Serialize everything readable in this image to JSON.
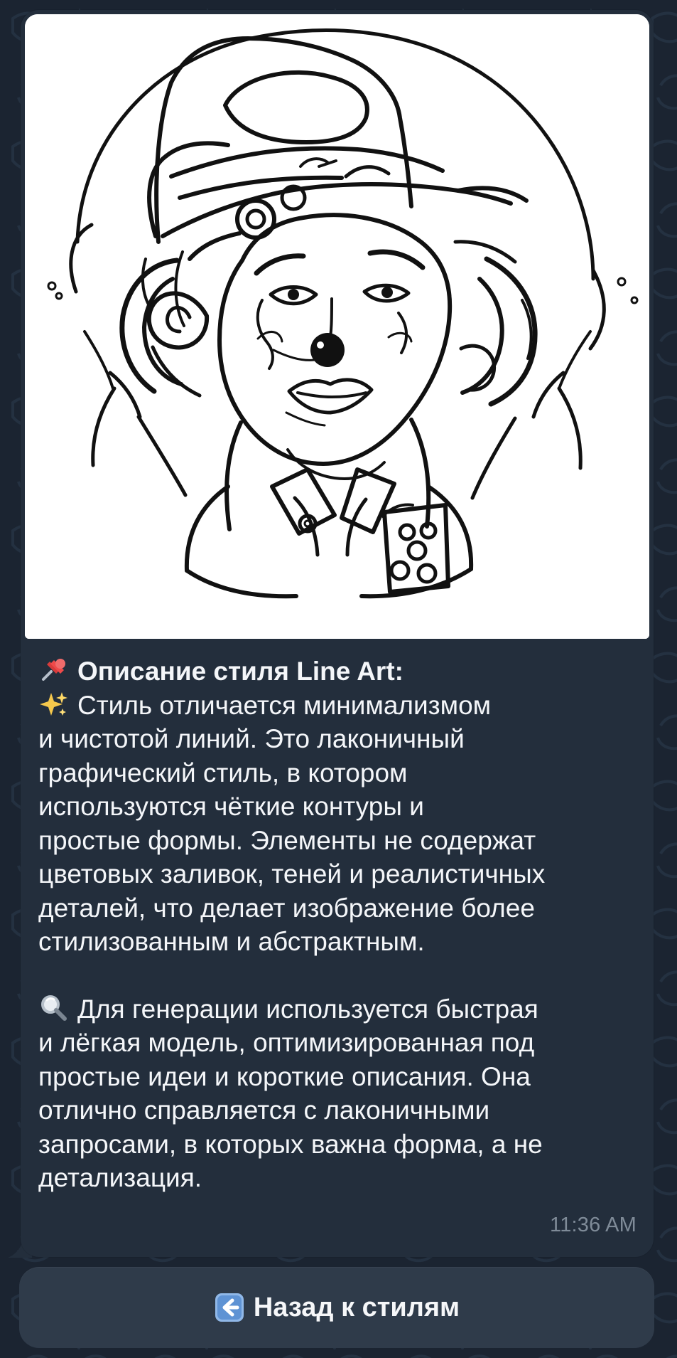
{
  "message": {
    "image_kind": "line-art-illustration",
    "title": {
      "emoji": "pin-icon",
      "text": "Описание стиля Line Art:"
    },
    "paragraphs": [
      {
        "emoji": "sparkles-icon",
        "lines": [
          "Стиль отличается минимализмом",
          "и чистотой линий. Это лаконичный",
          "графический стиль, в котором",
          "используются чёткие контуры и",
          "простые формы. Элементы не содержат",
          "цветовых заливок, теней и реалистичных",
          "деталей, что делает изображение более",
          "стилизованным и абстрактным."
        ]
      },
      {
        "emoji": "magnifier-icon",
        "lines": [
          "Для генерации используется быстрая",
          "и лёгкая модель, оптимизированная под",
          "простые идеи и короткие описания. Она",
          "отлично справляется с лаконичными",
          "запросами, в которых важна форма, а не",
          "детализация."
        ]
      }
    ],
    "time": "11:36 AM"
  },
  "keyboard": {
    "button_icon": "left-arrow-icon",
    "button_label": "Назад к стилям"
  },
  "colors": {
    "background": "#1b2431",
    "bubble": "#232e3c",
    "button": "#2f3b4a",
    "text": "#f4f6f9",
    "time": "#7f8b98"
  }
}
